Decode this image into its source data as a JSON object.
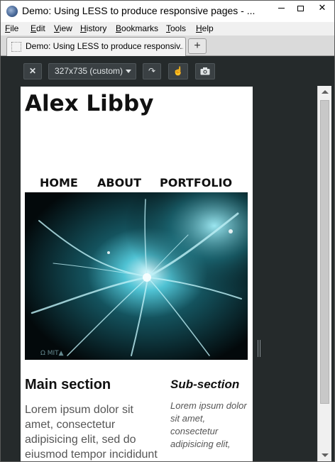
{
  "window": {
    "title": "Demo: Using LESS to produce responsive pages - ...",
    "minimize_glyph": "",
    "maximize_glyph": "",
    "close_glyph": "✕",
    "icon": "firefox-icon"
  },
  "menu": {
    "items": [
      {
        "label": "File"
      },
      {
        "label": "Edit"
      },
      {
        "label": "View"
      },
      {
        "label": "History"
      },
      {
        "label": "Bookmarks"
      },
      {
        "label": "Tools"
      },
      {
        "label": "Help"
      }
    ]
  },
  "tabs": {
    "active_title": "Demo: Using LESS to produce responsiv...",
    "new_tab_glyph": "+"
  },
  "responsive_toolbar": {
    "close_glyph": "✕",
    "viewport_size": "327x735 (custom)",
    "rotate_glyph": "↷",
    "touch_glyph": "☝",
    "screenshot_icon": "camera-icon",
    "colors": {
      "background": "#252a2b",
      "button": "#3a4043"
    }
  },
  "page": {
    "site_title": "Alex Libby",
    "nav": [
      "HOME",
      "ABOUT",
      "PORTFOLIO"
    ],
    "hero_watermark": "Ω MIT▲",
    "main_heading": "Main section",
    "main_text": "Lorem ipsum dolor sit amet, consectetur adipisicing elit, sed do eiusmod tempor incididunt",
    "sub_heading": "Sub-section",
    "sub_text": "Lorem ipsum dolor sit amet, consectetur adipisicing elit,"
  }
}
